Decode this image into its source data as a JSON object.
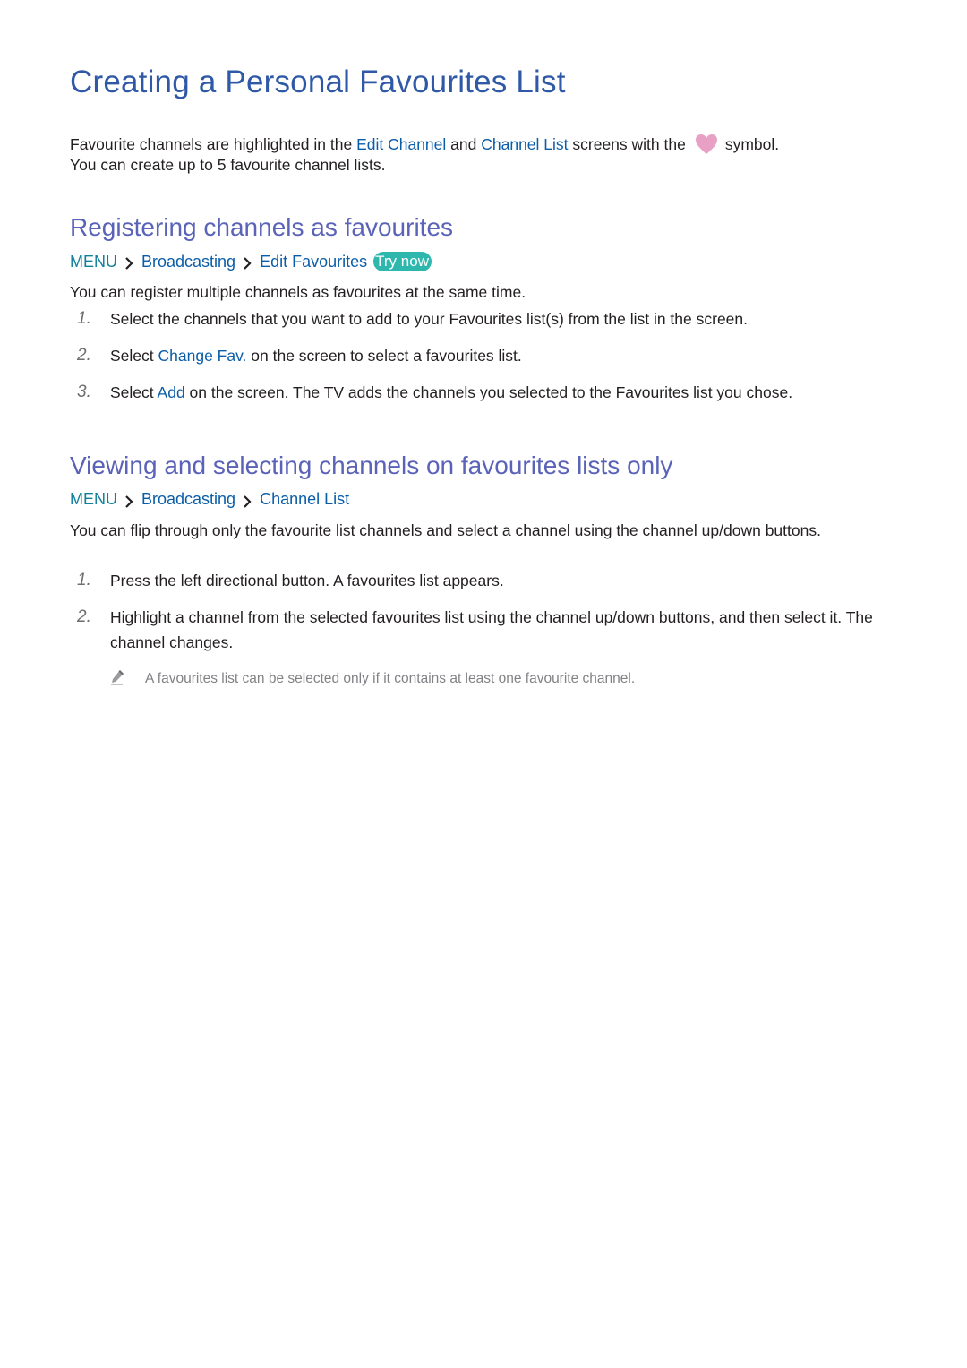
{
  "title": "Creating a Personal Favourites List",
  "intro": {
    "part1": "Favourite channels are highlighted in the ",
    "link1": "Edit Channel",
    "part2": " and ",
    "link2": "Channel List",
    "part3": " screens with the",
    "icon": "heart-icon",
    "part4": "symbol.",
    "line2": "You can create up to 5 favourite channel lists."
  },
  "colors": {
    "title": "#2f59a6",
    "section_heading": "#5a63b8",
    "menu": "#11809b",
    "link": "#0b5da8",
    "try_now_badge": "#2db7ad",
    "heart": "#e8a0c4",
    "note": "#808285"
  },
  "sections": [
    {
      "heading": "Registering channels as favourites",
      "breadcrumb": {
        "menu": "MENU",
        "items": [
          "Broadcasting",
          "Edit Favourites"
        ],
        "separator_icon": "chevron-right-icon",
        "badge": "Try now"
      },
      "description": "You can register multiple channels as favourites at the same time.",
      "steps": [
        {
          "num": "1.",
          "text": "Select the channels that you want to add to your Favourites list(s) from the list in the screen."
        },
        {
          "num": "2.",
          "pre": "Select ",
          "link": "Change Fav.",
          "post": " on the screen to select a favourites list."
        },
        {
          "num": "3.",
          "pre": "Select ",
          "link": "Add",
          "post": " on the screen. The TV adds the channels you selected to the Favourites list you chose."
        }
      ]
    },
    {
      "heading": "Viewing and selecting channels on favourites lists only",
      "breadcrumb": {
        "menu": "MENU",
        "items": [
          "Broadcasting",
          "Channel List"
        ],
        "separator_icon": "chevron-right-icon"
      },
      "description": "You can flip through only the favourite list channels and select a channel using the channel up/down buttons.",
      "steps": [
        {
          "num": "1.",
          "text": "Press the left directional button. A favourites list appears."
        },
        {
          "num": "2.",
          "text": "Highlight a channel from the selected favourites list using the channel up/down buttons, and then select it. The channel changes."
        }
      ],
      "note": {
        "icon": "pencil-icon",
        "text": "A favourites list can be selected only if it contains at least one favourite channel."
      }
    }
  ]
}
